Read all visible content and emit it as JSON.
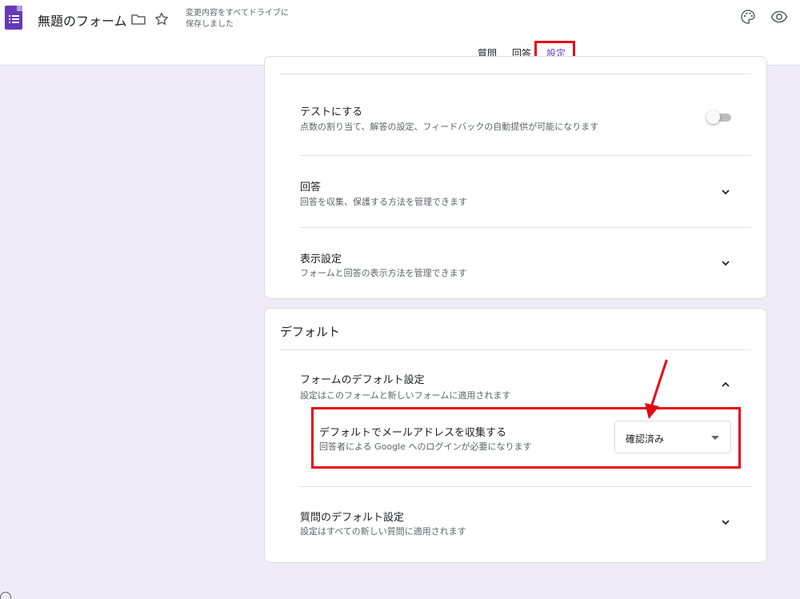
{
  "header": {
    "doc_title": "無題のフォーム",
    "save_status_line1": "変更内容をすべてドライブに",
    "save_status_line2": "保存しました"
  },
  "tabs": [
    {
      "label": "質問"
    },
    {
      "label": "回答"
    },
    {
      "label": "設定",
      "active": true
    }
  ],
  "settings": [
    {
      "title": "テストにする",
      "desc": "点数の割り当て、解答の設定、フィードバックの自動提供が可能になります",
      "control": "toggle",
      "on": false
    },
    {
      "title": "回答",
      "desc": "回答を収集、保護する方法を管理できます",
      "control": "expand"
    },
    {
      "title": "表示設定",
      "desc": "フォームと回答の表示方法を管理できます",
      "control": "expand"
    }
  ],
  "defaults": {
    "section_title": "デフォルト",
    "form_defaults": {
      "title": "フォームのデフォルト設定",
      "desc": "設定はこのフォームと新しいフォームに適用されます",
      "collect_email": {
        "title": "デフォルトでメールアドレスを収集する",
        "desc": "回答者による Google へのログインが必要になります",
        "selected": "確認済み"
      }
    },
    "question_defaults": {
      "title": "質問のデフォルト設定",
      "desc": "設定はすべての新しい質問に適用されます"
    }
  },
  "colors": {
    "accent": "#673ab7",
    "background": "#f0ebf8",
    "highlight": "#e50914"
  }
}
